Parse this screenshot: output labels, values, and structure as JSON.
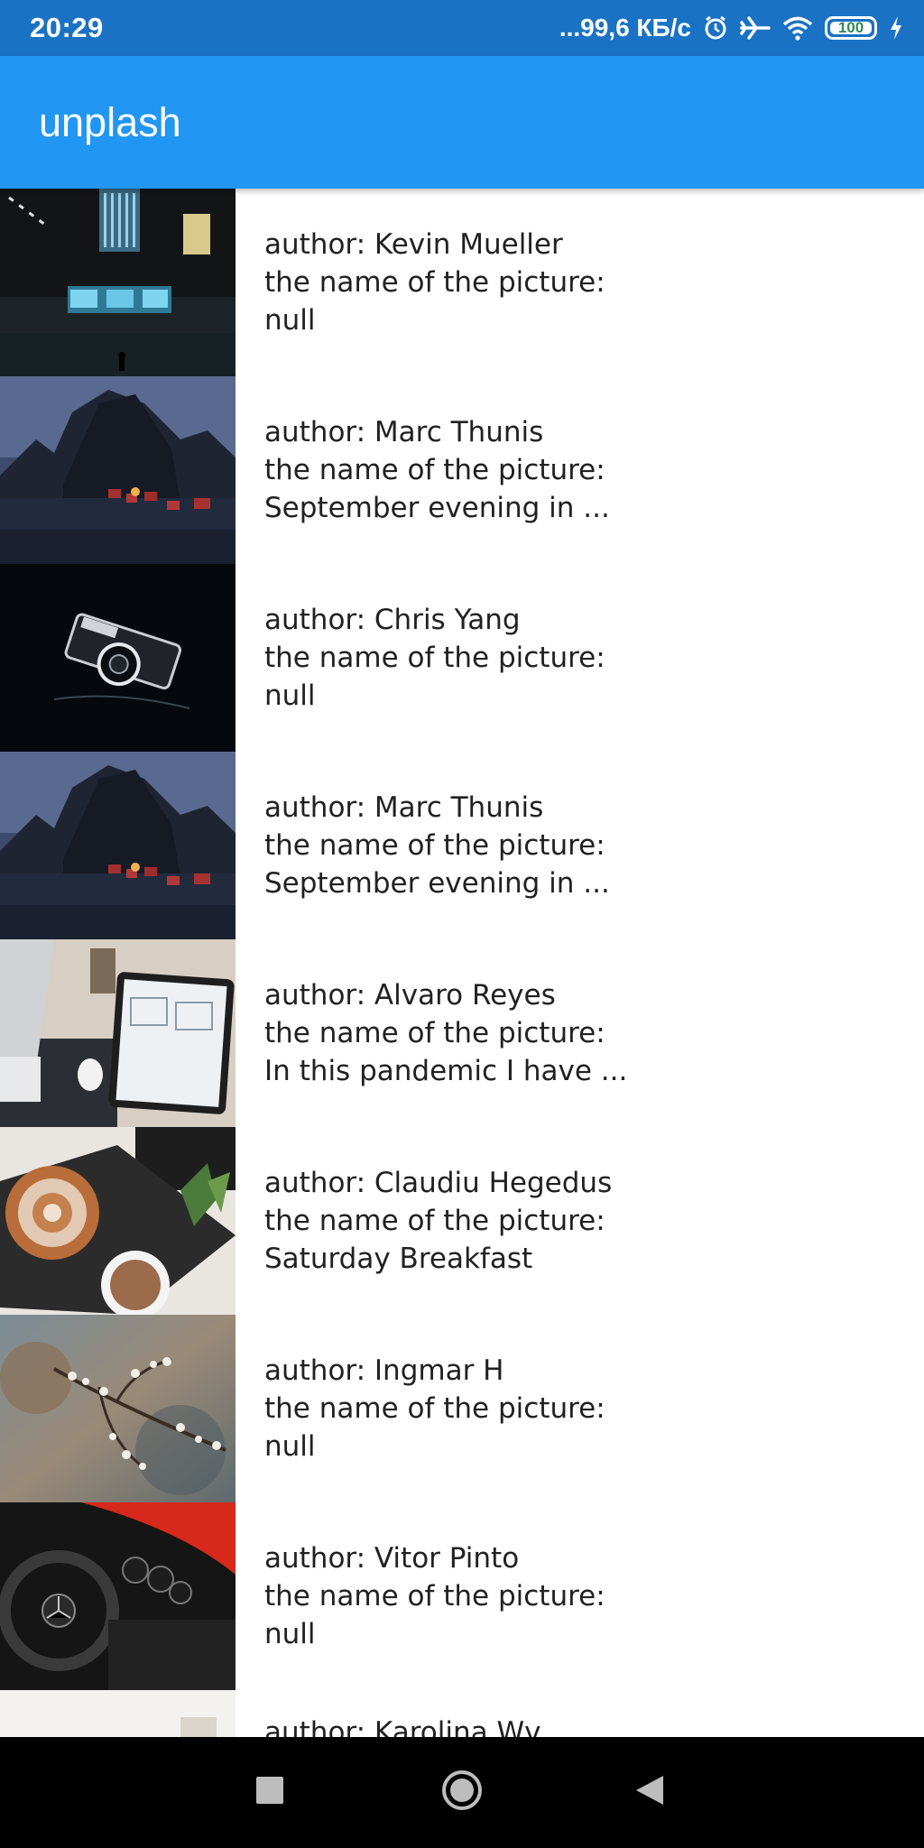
{
  "status_bar": {
    "time": "20:29",
    "network_speed": "...99,6 КБ/с",
    "battery_level": "100",
    "icons": [
      "alarm-icon",
      "airplane-icon",
      "wifi-icon",
      "battery-icon",
      "charging-icon"
    ]
  },
  "app_bar": {
    "title": "unplash",
    "color": "#2196f3"
  },
  "list": {
    "items": [
      {
        "author": "author: Kevin Mueller",
        "name_label": "the name of the picture:",
        "name": "null",
        "thumbnail": "dark-hallway-photo"
      },
      {
        "author": "author: Marc Thunis",
        "name_label": "the name of the picture:",
        "name": "September evening in ...",
        "thumbnail": "mountain-village-photo"
      },
      {
        "author": "author: Chris Yang",
        "name_label": "the name of the picture:",
        "name": "null",
        "thumbnail": "camera-photo"
      },
      {
        "author": "author: Marc Thunis",
        "name_label": "the name of the picture:",
        "name": "September evening in ...",
        "thumbnail": "mountain-village-photo"
      },
      {
        "author": "author: Alvaro Reyes",
        "name_label": "the name of the picture:",
        "name": "In this pandemic I have ...",
        "thumbnail": "desk-tablet-photo"
      },
      {
        "author": "author: Claudiu Hegedus",
        "name_label": "the name of the picture:",
        "name": "Saturday Breakfast",
        "thumbnail": "breakfast-photo"
      },
      {
        "author": "author: Ingmar H",
        "name_label": "the name of the picture:",
        "name": "null",
        "thumbnail": "blossom-branch-photo"
      },
      {
        "author": "author: Vitor Pinto",
        "name_label": "the name of the picture:",
        "name": "null",
        "thumbnail": "car-interior-photo"
      },
      {
        "author": "author: Karolina Wv",
        "name_label": "",
        "name": "",
        "thumbnail": "light-photo"
      }
    ]
  },
  "nav_bar": {
    "buttons": [
      "recents-icon",
      "home-icon",
      "back-icon"
    ]
  }
}
